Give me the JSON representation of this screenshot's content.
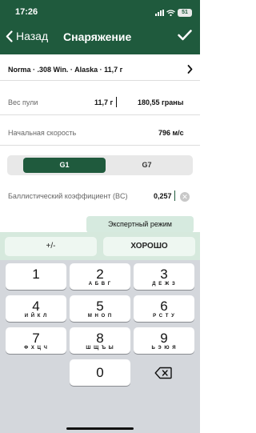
{
  "status": {
    "time": "17:26",
    "battery": "51"
  },
  "nav": {
    "back_label": "Назад",
    "title": "Снаряжение"
  },
  "ammo": {
    "label": "Norma · .308 Win. · Alaska · 11,7 г"
  },
  "bullet_weight": {
    "label": "Вес пули",
    "grams": "11,7 г",
    "grains": "180,55 граны"
  },
  "velocity": {
    "label": "Начальная скорость",
    "value": "796 м/с"
  },
  "drag_model": {
    "options": [
      "G1",
      "G7"
    ],
    "selected": "G1"
  },
  "bc": {
    "label": "Баллистический коэффициент (BC)",
    "value": "0,257"
  },
  "expert_label": "Экспертный режим",
  "accessory": {
    "plusminus_label": "+/-",
    "ok_label": "ХОРОШО"
  },
  "keypad": {
    "keys": [
      {
        "digit": "1",
        "letters": ""
      },
      {
        "digit": "2",
        "letters": "А Б В Г"
      },
      {
        "digit": "3",
        "letters": "Д Е Ж З"
      },
      {
        "digit": "4",
        "letters": "И Й К Л"
      },
      {
        "digit": "5",
        "letters": "М Н О П"
      },
      {
        "digit": "6",
        "letters": "Р С Т У"
      },
      {
        "digit": "7",
        "letters": "Ф Х Ц Ч"
      },
      {
        "digit": "8",
        "letters": "Ш Щ Ъ Ы"
      },
      {
        "digit": "9",
        "letters": "Ь Э Ю Я"
      },
      {
        "digit": "0",
        "letters": ""
      }
    ]
  },
  "colors": {
    "brand": "#1f5a3d",
    "accent_light": "#d6eadf",
    "keyboard_bg": "#d4d7dc"
  },
  "icons": [
    "chevron-left-icon",
    "checkmark-icon",
    "chevron-right-icon",
    "clear-icon",
    "delete-backspace-icon",
    "signal-icon",
    "wifi-icon",
    "battery-icon"
  ]
}
